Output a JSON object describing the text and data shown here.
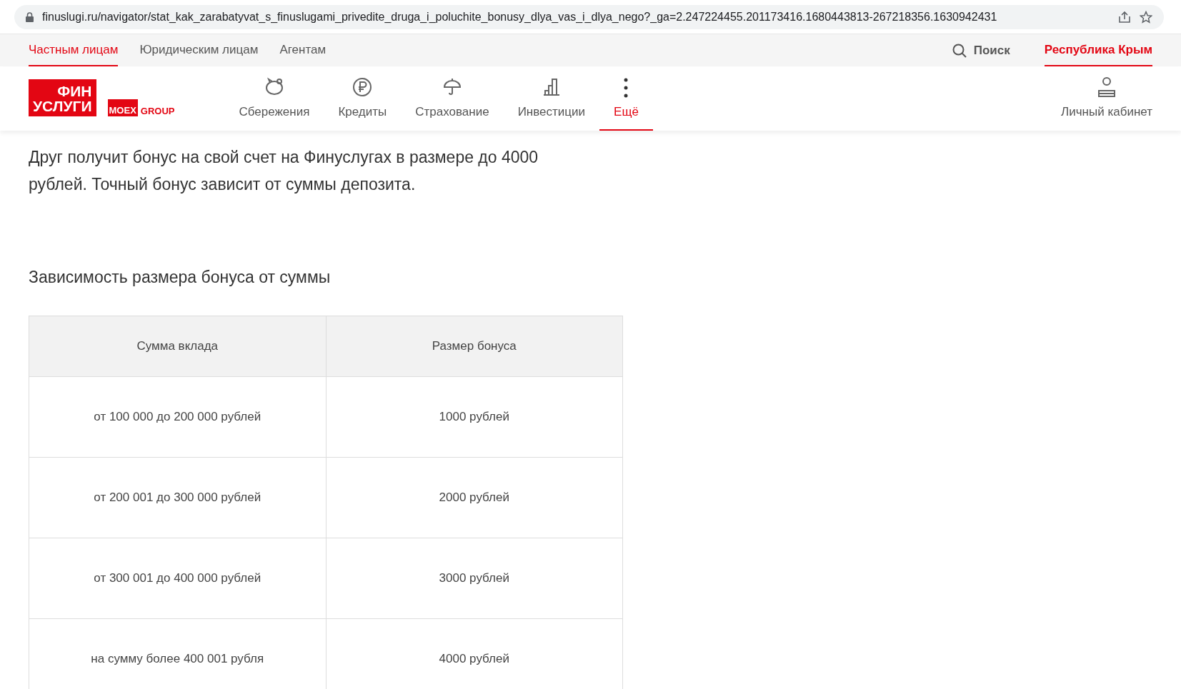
{
  "address_bar": {
    "url": "finuslugi.ru/navigator/stat_kak_zarabatyvat_s_finuslugami_privedite_druga_i_poluchite_bonusy_dlya_vas_i_dlya_nego?_ga=2.247224455.201173416.1680443813-267218356.1630942431"
  },
  "top_tabs": [
    {
      "label": "Частным лицам",
      "selected": true
    },
    {
      "label": "Юридическим лицам",
      "selected": false
    },
    {
      "label": "Агентам",
      "selected": false
    }
  ],
  "search": {
    "label": "Поиск"
  },
  "region": {
    "label": "Республика Крым"
  },
  "logo": {
    "line_1": "ФИН",
    "line_2": "УСЛУГИ",
    "badge": "MOEX",
    "group": "GROUP"
  },
  "main_nav": [
    {
      "kind": "piggy",
      "label": "Сбережения",
      "selected": false
    },
    {
      "kind": "ruble",
      "label": "Кредиты",
      "selected": false
    },
    {
      "kind": "umbrella",
      "label": "Страхование",
      "selected": false
    },
    {
      "kind": "chart",
      "label": "Инвестиции",
      "selected": false
    },
    {
      "kind": "more",
      "label": "Ещё",
      "selected": true
    }
  ],
  "account": {
    "label": "Личный кабинет"
  },
  "intro": "Друг получит бонус на свой счет на Финуслугах в размере до 4000 рублей. Точный бонус зависит от суммы депозита.",
  "section_title": "Зависимость размера бонуса от суммы",
  "table": {
    "columns": [
      "Сумма вклада",
      "Размер бонуса"
    ],
    "rows": [
      [
        "от 100 000 до 200 000 рублей",
        "1000 рублей"
      ],
      [
        "от 200 001 до 300 000 рублей",
        "2000 рублей"
      ],
      [
        "от 300 001 до 400 000 рублей",
        "3000 рублей"
      ],
      [
        "на сумму более 400 001 рубля",
        "4000 рублей"
      ]
    ]
  }
}
